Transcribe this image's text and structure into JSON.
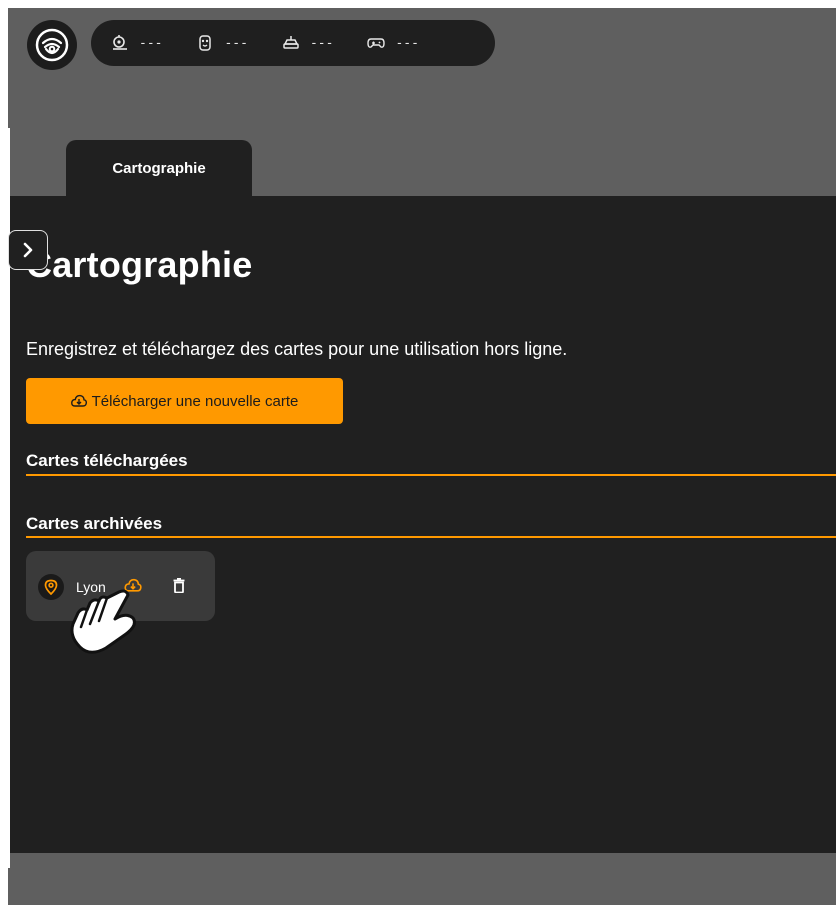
{
  "status_bar": {
    "items": [
      {
        "icon": "robot-icon",
        "value": "---"
      },
      {
        "icon": "battery-icon",
        "value": "---"
      },
      {
        "icon": "vehicle-icon",
        "value": "---"
      },
      {
        "icon": "gamepad-icon",
        "value": "---"
      }
    ]
  },
  "tabs": [
    {
      "label": "Cartographie",
      "active": true
    }
  ],
  "page": {
    "title": "Cartographie",
    "description": "Enregistrez et téléchargez des cartes pour une utilisation hors ligne.",
    "download_button": "Télécharger une nouvelle carte"
  },
  "sections": {
    "downloaded": {
      "title": "Cartes téléchargées",
      "items": []
    },
    "archived": {
      "title": "Cartes archivées",
      "items": [
        {
          "name": "Lyon",
          "icon": "map-pin-icon"
        }
      ]
    }
  },
  "colors": {
    "accent": "#ff9900",
    "panel": "#202020",
    "frame": "#5f5f5f",
    "card": "#3a3a3a"
  }
}
